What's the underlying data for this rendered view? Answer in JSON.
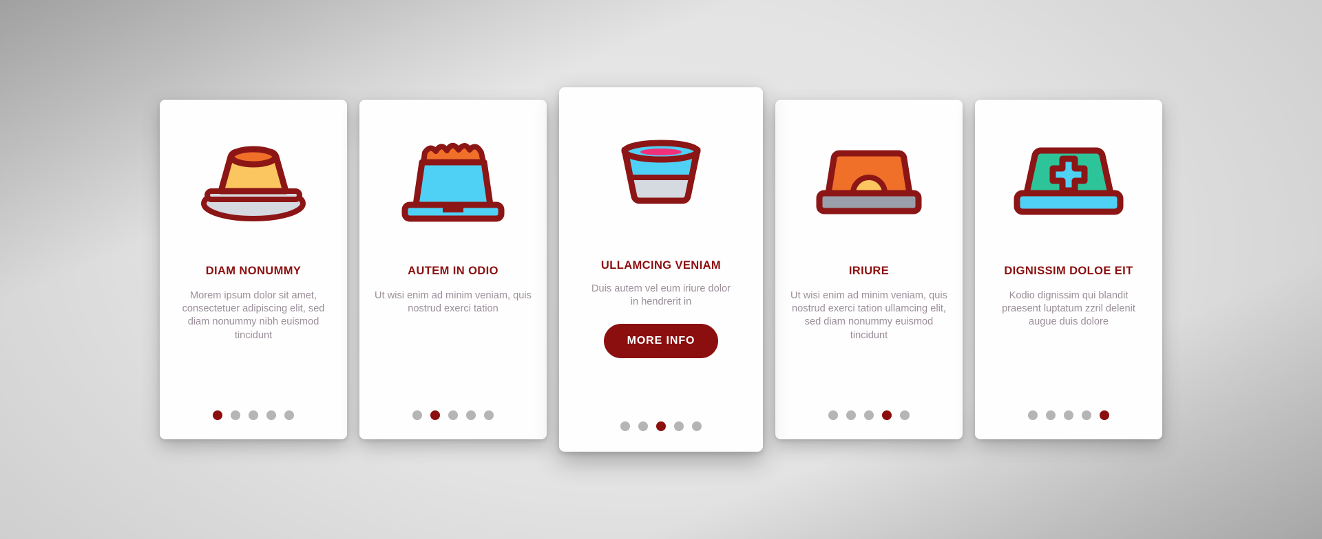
{
  "palette": {
    "background_light": "#e9e9e9",
    "background_dark": "#bcbcbc",
    "card_bg": "#fefefe",
    "accent_dark_red": "#8c0f0f",
    "outline_red": "#8c1616",
    "body_text": "#9b8e99",
    "dot_inactive": "#b5b5b5",
    "icon_orange": "#f0702a",
    "icon_amber": "#fbc55f",
    "icon_cyan": "#4fd1f5",
    "icon_green": "#2ec49a",
    "icon_gray": "#d5d9e0",
    "icon_pink": "#f0307a",
    "icon_slate": "#9aa0ab"
  },
  "cards": [
    {
      "icon_name": "pet-food-bowl-filled-icon",
      "title": "DIAM NONUMMY",
      "body": "Morem ipsum dolor sit amet, consectetuer adipiscing elit, sed diam nonummy nibh euismod tincidunt",
      "dots": {
        "count": 5,
        "active_index": 0
      },
      "featured": false,
      "cta": null
    },
    {
      "icon_name": "pet-bowl-with-kibble-icon",
      "title": "AUTEM IN ODIO",
      "body": "Ut wisi enim ad minim veniam, quis nostrud exerci tation",
      "dots": {
        "count": 5,
        "active_index": 1
      },
      "featured": false,
      "cta": null
    },
    {
      "icon_name": "water-bowl-icon",
      "title": "ULLAMCING VENIAM",
      "body": "Duis autem vel eum iriure dolor in hendrerit in",
      "dots": {
        "count": 5,
        "active_index": 2
      },
      "featured": true,
      "cta": "MORE INFO"
    },
    {
      "icon_name": "pet-feeder-tray-icon",
      "title": "IRIURE",
      "body": "Ut wisi enim ad minim veniam, quis nostrud exerci tation ullamcing elit, sed diam nonummy euismod tincidunt",
      "dots": {
        "count": 5,
        "active_index": 3
      },
      "featured": false,
      "cta": null
    },
    {
      "icon_name": "medical-pet-bowl-cross-icon",
      "title": "DIGNISSIM DOLOE EIT",
      "body": "Kodio dignissim qui blandit praesent luptatum zzril delenit augue duis dolore",
      "dots": {
        "count": 5,
        "active_index": 4
      },
      "featured": false,
      "cta": null
    }
  ]
}
